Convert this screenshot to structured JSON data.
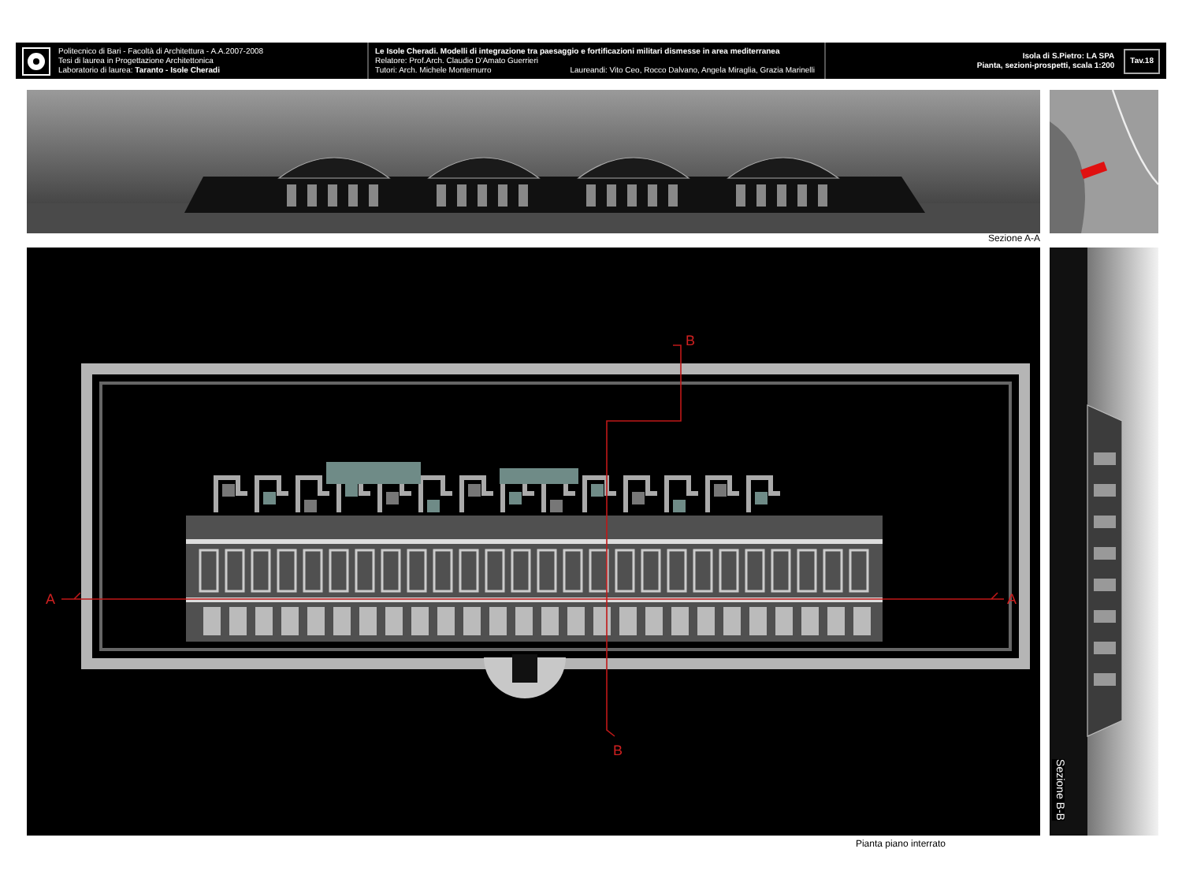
{
  "header": {
    "institution_lines": [
      "Politecnico di Bari - Facoltà di Architettura - A.A.2007-2008",
      "Tesi di laurea in Progettazione Architettonica",
      "Laboratorio di laurea: **Taranto - Isole Cheradi**"
    ],
    "project": {
      "title": "Le Isole Cheradi. Modelli di integrazione tra paesaggio e fortificazioni militari dismesse in area mediterranea",
      "advisor": "Relatore: Prof.Arch. Claudio D'Amato Guerrieri",
      "tutors": "Tutori: Arch. Michele Montemurro",
      "students": "Laureandi: Vito Ceo, Rocco Dalvano, Angela Miraglia, Grazia Marinelli"
    },
    "sheet": {
      "subject": "Isola di S.Pietro: LA SPA",
      "content": "Pianta, sezioni-prospetti, scala 1:200",
      "number": "Tav.18"
    }
  },
  "section_aa": {
    "label": "Sezione A-A"
  },
  "plan": {
    "label": "Pianta piano interrato",
    "section_marks": [
      "A",
      "A",
      "B",
      "B"
    ]
  },
  "section_bb": {
    "label": "Sezione B-B"
  }
}
